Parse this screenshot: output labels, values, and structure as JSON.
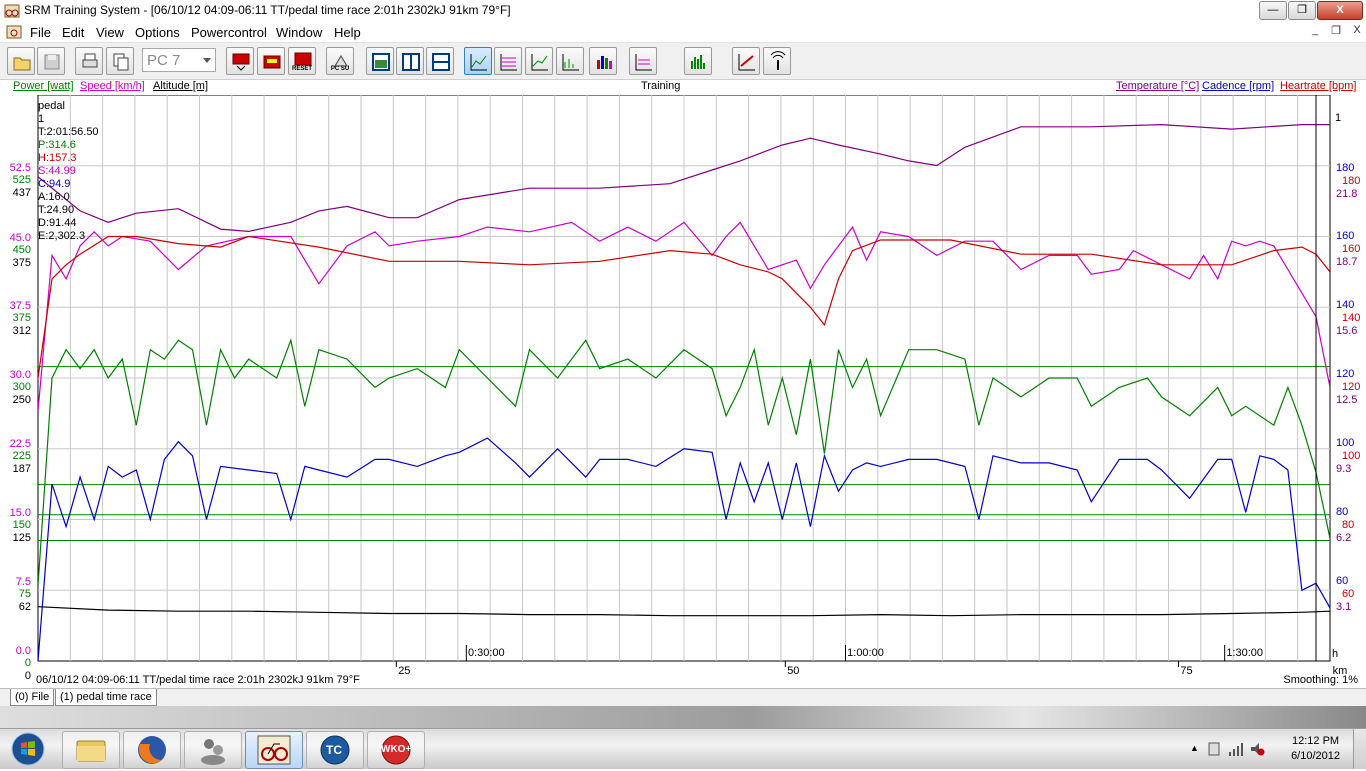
{
  "window": {
    "title": "SRM Training System - [06/10/12 04:09-06:11 TT/pedal time race 2:01h 2302kJ 91km 79°F]",
    "buttons": {
      "minimize": "—",
      "maximize": "❐",
      "close": "X"
    }
  },
  "menubar": {
    "items": [
      "File",
      "Edit",
      "View",
      "Options",
      "Powercontrol",
      "Window",
      "Help"
    ],
    "mdi_buttons": [
      "_",
      "❐",
      "X"
    ]
  },
  "toolbar": {
    "pc_selector": "PC 7",
    "button_labels": {
      "reset": "RESET",
      "pc_su": "PC SU"
    }
  },
  "legend_left": [
    {
      "label": "Power [watt]",
      "color": "#008000"
    },
    {
      "label": "Speed [km/h]",
      "color": "#cc00cc"
    },
    {
      "label": "Altitude [m]",
      "color": "#000000"
    }
  ],
  "legend_right": [
    {
      "label": "Temperature [°C]",
      "color": "#800080"
    },
    {
      "label": "Cadence [rpm]",
      "color": "#0000cc"
    },
    {
      "label": "Heartrate [bpm]",
      "color": "#cc0000"
    }
  ],
  "plot_label": "Training",
  "cursor_info": [
    {
      "text": "pedal",
      "color": "#000000"
    },
    {
      "text": "1",
      "color": "#000000"
    },
    {
      "text": "T:2:01:56.50",
      "color": "#000000"
    },
    {
      "text": "P:314.6",
      "color": "#008000"
    },
    {
      "text": "H:157.3",
      "color": "#cc0000"
    },
    {
      "text": "S:44.99",
      "color": "#cc00cc"
    },
    {
      "text": "C:94.9",
      "color": "#0000cc"
    },
    {
      "text": "A:16.0",
      "color": "#000000"
    },
    {
      "text": "T:24.90",
      "color": "#000000"
    },
    {
      "text": "D:91.44",
      "color": "#000000"
    },
    {
      "text": "E:2,302.3",
      "color": "#000000"
    }
  ],
  "chart_data": {
    "type": "line",
    "x_unit": "km",
    "x_range": [
      0,
      92
    ],
    "time_ticks": [
      "0:30:00",
      "1:00:00",
      "1:30:00"
    ],
    "distance_ticks": [
      "25",
      "50",
      "75"
    ],
    "x_axis_end_label": "km",
    "left_axes": {
      "speed": {
        "color": "#cc00cc",
        "ticks": [
          "52.5",
          "45.0",
          "37.5",
          "30.0",
          "22.5",
          "15.0",
          "7.5",
          "0.0"
        ]
      },
      "power": {
        "color": "#008000",
        "ticks": [
          "525",
          "450",
          "375",
          "300",
          "225",
          "150",
          "75",
          "0"
        ]
      },
      "altitude": {
        "color": "#000000",
        "ticks": [
          "437",
          "375",
          "312",
          "250",
          "187",
          "125",
          "62",
          "0"
        ]
      }
    },
    "right_axes": {
      "cadence": {
        "color": "#0000cc",
        "ticks": [
          "180",
          "160",
          "140",
          "120",
          "100",
          "80",
          "60"
        ]
      },
      "heartrate": {
        "color": "#cc0000",
        "ticks": [
          "180",
          "160",
          "140",
          "120",
          "100",
          "80",
          "60"
        ]
      },
      "temperature": {
        "color": "#800080",
        "ticks": [
          "21.8",
          "18.7",
          "15.6",
          "12.5",
          "9.3",
          "6.2",
          "3.1"
        ]
      }
    },
    "right_axis_top_label": "1",
    "series": [
      {
        "name": "Temperature [°C]",
        "color": "#800080",
        "x": [
          0,
          3,
          5,
          7,
          10,
          13,
          15,
          18,
          20,
          22,
          25,
          27,
          30,
          35,
          40,
          45,
          48,
          50,
          53,
          55,
          57,
          60,
          62,
          64,
          66,
          70,
          75,
          80,
          85,
          90,
          92
        ],
        "y": [
          21.3,
          19.8,
          19.3,
          19.7,
          19.9,
          19.0,
          18.9,
          19.3,
          19.8,
          20.0,
          19.5,
          19.5,
          20.3,
          20.8,
          20.8,
          21.0,
          21.6,
          22.0,
          22.7,
          23.0,
          22.7,
          22.3,
          22.0,
          21.8,
          22.6,
          23.5,
          23.5,
          23.6,
          23.4,
          23.6,
          23.6
        ]
      },
      {
        "name": "Speed [km/h]",
        "color": "#cc00cc",
        "x": [
          0,
          1,
          2,
          3,
          4,
          5,
          6,
          8,
          10,
          12,
          15,
          18,
          20,
          22,
          24,
          25,
          27,
          30,
          32,
          35,
          38,
          40,
          42,
          44,
          46,
          48,
          49,
          50,
          52,
          54,
          55,
          56,
          57,
          58,
          59,
          60,
          62,
          64,
          66,
          68,
          70,
          72,
          74,
          75,
          77,
          78,
          80,
          82,
          83,
          84,
          85,
          86,
          87,
          88,
          89,
          90,
          91,
          92
        ],
        "y": [
          26.5,
          43.0,
          40.5,
          44.0,
          45.5,
          44.0,
          45.0,
          44.5,
          41.5,
          44.0,
          45.0,
          45.0,
          40.0,
          44.0,
          45.5,
          44.0,
          44.5,
          45.0,
          46.0,
          45.5,
          46.5,
          44.5,
          46.0,
          44.5,
          46.5,
          43.0,
          45.0,
          46.5,
          41.5,
          42.5,
          39.5,
          42.0,
          44.0,
          46.0,
          42.5,
          45.5,
          45.0,
          43.0,
          44.5,
          44.5,
          41.5,
          43.0,
          43.0,
          41.0,
          41.5,
          43.5,
          42.0,
          40.5,
          43.0,
          40.5,
          44.5,
          44.0,
          44.5,
          44.0,
          41.5,
          39.0,
          36.5,
          29.0
        ]
      },
      {
        "name": "Heartrate [bpm]",
        "color": "#cc0000",
        "x": [
          0,
          1,
          2,
          3,
          5,
          7,
          10,
          13,
          15,
          20,
          25,
          30,
          35,
          40,
          45,
          48,
          50,
          52,
          53,
          55,
          56,
          57,
          58,
          60,
          65,
          70,
          75,
          80,
          85,
          88,
          90,
          91,
          92
        ],
        "y": [
          120,
          148,
          152,
          155,
          160,
          160,
          158,
          157,
          160,
          157,
          153,
          153,
          152,
          153,
          156,
          155,
          152,
          150,
          148,
          140,
          135,
          148,
          156,
          159,
          159,
          155,
          155,
          152,
          152,
          156,
          157,
          155,
          150
        ]
      },
      {
        "name": "Power [watt]",
        "color": "#008000",
        "x": [
          0,
          1,
          2,
          3,
          4,
          5,
          6,
          7,
          8,
          9,
          10,
          11,
          12,
          13,
          14,
          15,
          17,
          18,
          19,
          20,
          22,
          24,
          25,
          27,
          29,
          30,
          32,
          34,
          35,
          37,
          39,
          40,
          42,
          44,
          46,
          48,
          49,
          50,
          51,
          52,
          53,
          54,
          55,
          56,
          57,
          58,
          59,
          60,
          62,
          64,
          66,
          67,
          68,
          70,
          72,
          74,
          75,
          77,
          79,
          80,
          82,
          84,
          85,
          86,
          87,
          88,
          89,
          90,
          91,
          92
        ],
        "y": [
          80,
          300,
          330,
          310,
          330,
          300,
          320,
          250,
          330,
          320,
          340,
          330,
          250,
          330,
          300,
          320,
          300,
          340,
          270,
          330,
          320,
          290,
          300,
          310,
          290,
          330,
          300,
          270,
          330,
          300,
          340,
          310,
          320,
          300,
          330,
          310,
          260,
          290,
          330,
          250,
          300,
          240,
          320,
          220,
          330,
          290,
          320,
          260,
          330,
          330,
          320,
          250,
          300,
          280,
          300,
          300,
          270,
          290,
          300,
          280,
          260,
          290,
          260,
          270,
          260,
          250,
          290,
          250,
          200,
          130
        ]
      },
      {
        "name": "Cadence [rpm]",
        "color": "#0000cc",
        "x": [
          0,
          1,
          2,
          3,
          4,
          5,
          6,
          7,
          8,
          9,
          10,
          11,
          12,
          13,
          15,
          17,
          18,
          19,
          20,
          22,
          24,
          25,
          27,
          29,
          30,
          32,
          34,
          35,
          37,
          39,
          40,
          42,
          44,
          46,
          48,
          49,
          50,
          51,
          52,
          53,
          54,
          55,
          56,
          57,
          58,
          59,
          60,
          62,
          64,
          66,
          67,
          68,
          70,
          72,
          74,
          75,
          77,
          79,
          80,
          82,
          84,
          85,
          86,
          87,
          88,
          89,
          90,
          91,
          92
        ],
        "y": [
          30,
          90,
          78,
          92,
          80,
          95,
          92,
          94,
          80,
          97,
          102,
          98,
          80,
          95,
          94,
          93,
          80,
          95,
          94,
          92,
          97,
          97,
          95,
          98,
          99,
          103,
          96,
          92,
          100,
          92,
          97,
          97,
          95,
          100,
          99,
          80,
          96,
          85,
          96,
          80,
          96,
          78,
          98,
          88,
          94,
          96,
          95,
          97,
          97,
          95,
          80,
          98,
          96,
          96,
          94,
          85,
          97,
          97,
          94,
          86,
          97,
          97,
          82,
          98,
          97,
          94,
          60,
          62,
          55
        ]
      },
      {
        "name": "Altitude [m]",
        "color": "#000000",
        "x": [
          0,
          5,
          10,
          15,
          20,
          25,
          30,
          35,
          40,
          45,
          50,
          55,
          60,
          65,
          70,
          75,
          80,
          85,
          90,
          92
        ],
        "y": [
          48,
          45,
          44,
          44,
          43,
          42,
          42,
          41,
          41,
          40,
          40,
          40,
          41,
          40,
          41,
          41,
          41,
          42,
          43,
          44
        ]
      }
    ],
    "reference_lines_power": [
      312,
      187
    ],
    "grid": true
  },
  "status": {
    "left": "06/10/12 04:09-06:11 TT/pedal time race 2:01h 2302kJ 91km 79°F",
    "right": "Smoothing: 1%"
  },
  "tabs": [
    "(0) File",
    "(1) pedal time race"
  ],
  "taskbar": {
    "clock_time": "12:12 PM",
    "clock_date": "6/10/2012",
    "apps": [
      "start-orb",
      "explorer",
      "firefox",
      "messenger",
      "srm",
      "trainingpeaks-tc",
      "wko-plus"
    ],
    "tc_label": "TC",
    "wko_label": "WKO+"
  }
}
